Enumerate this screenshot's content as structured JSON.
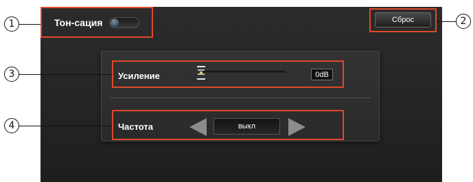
{
  "colors": {
    "highlight": "#e04a2a",
    "screen_bg": "#262626",
    "text": "#ffffff"
  },
  "tone": {
    "label": "Тон-сация",
    "enabled": false
  },
  "reset_button": {
    "label": "Сброс"
  },
  "gain": {
    "label": "Усиление",
    "value": "0dB",
    "slider_level": 0.0
  },
  "frequency": {
    "label": "Частота",
    "value": "выкл",
    "prev_icon": "triangle-left-icon",
    "next_icon": "triangle-right-icon"
  },
  "callouts": [
    "1",
    "2",
    "3",
    "4"
  ]
}
